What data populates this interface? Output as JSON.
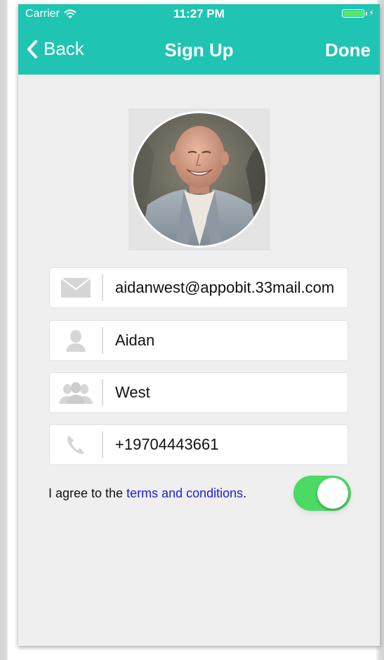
{
  "status_bar": {
    "carrier": "Carrier",
    "time": "11:27 PM",
    "battery_color": "#5ee65e"
  },
  "navbar": {
    "back_label": "Back",
    "title": "Sign Up",
    "done_label": "Done",
    "background_color": "#20c4b2"
  },
  "form": {
    "email": {
      "value": "aidanwest@appobit.33mail.com",
      "icon": "envelope-icon"
    },
    "first_name": {
      "value": "Aidan",
      "icon": "person-icon"
    },
    "last_name": {
      "value": "West",
      "icon": "group-icon"
    },
    "phone": {
      "value": "+19704443661",
      "icon": "phone-icon"
    }
  },
  "agreement": {
    "prefix": "I agree to the ",
    "link_text": "terms and conditions",
    "suffix": ".",
    "link_color": "#1b1bea",
    "toggle_on": true,
    "toggle_color": "#4cd964"
  }
}
